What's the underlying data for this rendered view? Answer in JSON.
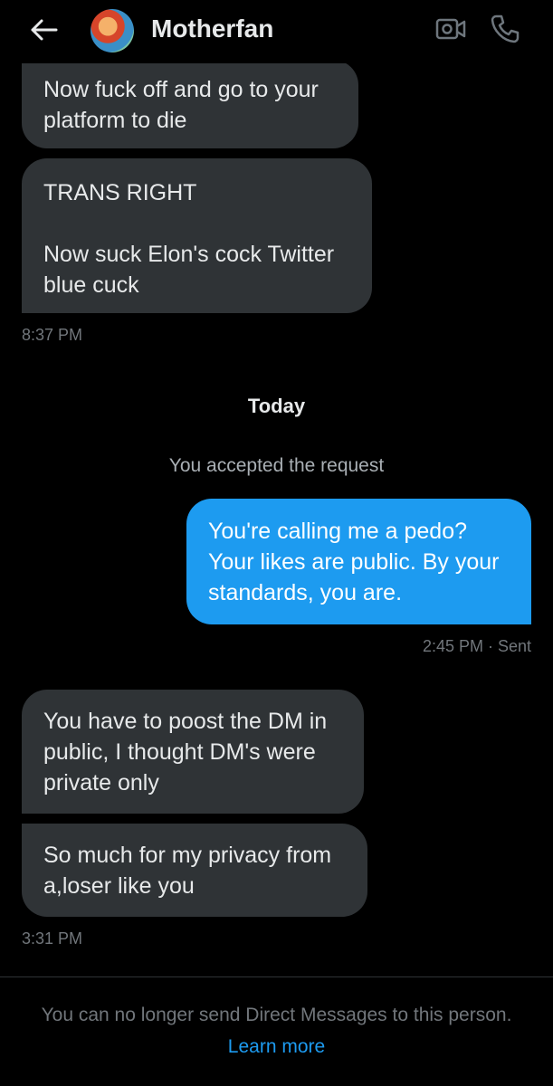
{
  "header": {
    "title": "Motherfan"
  },
  "messages": [
    {
      "text": "Now fuck off and go to your\nplatform to die"
    },
    {
      "text": "TRANS RIGHT\n\nNow suck Elon's cock Twitter\nblue cuck"
    }
  ],
  "time1": "8:37 PM",
  "day_label": "Today",
  "system_note": "You accepted the request",
  "sent_message": "You're calling me a pedo?\nYour likes are public. By your\nstandards, you are.",
  "sent_status": "2:45 PM · Sent",
  "messages2": [
    {
      "text": "You have to poost the DM in\npublic, I thought DM's were\nprivate only"
    },
    {
      "text": "So much for my privacy from\na,loser like you"
    }
  ],
  "time2": "3:31 PM",
  "footer": {
    "notice": "You can no longer send Direct Messages to this person.",
    "link": "Learn more"
  },
  "colors": {
    "accent": "#1d9bf0",
    "bubble_received": "#2f3336",
    "background": "#000000"
  }
}
